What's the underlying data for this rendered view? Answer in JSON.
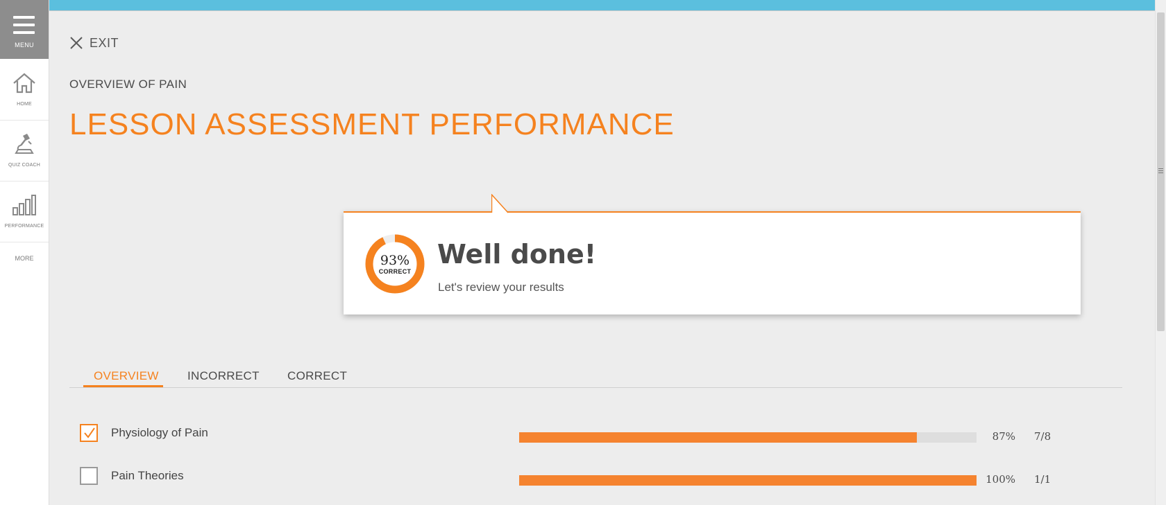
{
  "sidebar": {
    "menu_label": "MENU",
    "items": [
      {
        "label": "HOME",
        "icon": "home-icon"
      },
      {
        "label": "QUIZ COACH",
        "icon": "quiz-coach-icon"
      },
      {
        "label": "PERFORMANCE",
        "icon": "performance-icon"
      }
    ],
    "more_label": "MORE"
  },
  "header": {
    "exit_label": "EXIT",
    "eyebrow": "OVERVIEW OF PAIN",
    "title": "LESSON ASSESSMENT PERFORMANCE"
  },
  "result": {
    "percent_text": "93%",
    "percent_value": 93,
    "correct_label": "CORRECT",
    "heading": "Well done!",
    "subheading": "Let's review your results"
  },
  "tabs": [
    {
      "label": "OVERVIEW",
      "active": true
    },
    {
      "label": "INCORRECT",
      "active": false
    },
    {
      "label": "CORRECT",
      "active": false
    }
  ],
  "topics": [
    {
      "name": "Physiology of Pain",
      "checked": true,
      "percent": 87,
      "percent_text": "87%",
      "score": "7/8"
    },
    {
      "name": "Pain Theories",
      "checked": false,
      "percent": 100,
      "percent_text": "100%",
      "score": "1/1"
    }
  ],
  "colors": {
    "accent": "#f5821f",
    "topbar": "#5bbfde",
    "menu_bg": "#8d8d8d"
  }
}
